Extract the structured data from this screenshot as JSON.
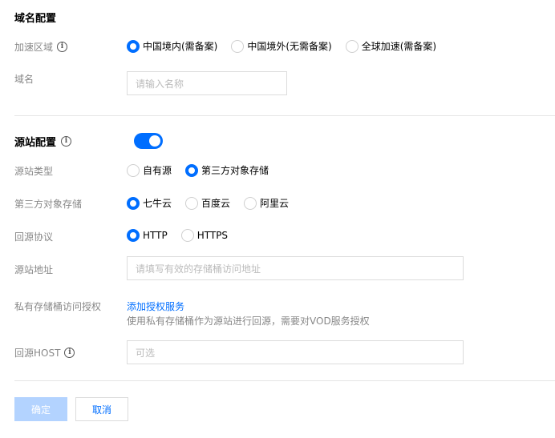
{
  "domain_section": {
    "title": "域名配置",
    "region_label": "加速区域",
    "region_options": [
      {
        "label": "中国境内(需备案)",
        "checked": true
      },
      {
        "label": "中国境外(无需备案)",
        "checked": false
      },
      {
        "label": "全球加速(需备案)",
        "checked": false
      }
    ],
    "domain_label": "域名",
    "domain_placeholder": "请输入名称"
  },
  "origin_section": {
    "title": "源站配置",
    "enabled": true,
    "type_label": "源站类型",
    "type_options": [
      {
        "label": "自有源",
        "checked": false
      },
      {
        "label": "第三方对象存储",
        "checked": true
      }
    ],
    "storage_label": "第三方对象存储",
    "storage_options": [
      {
        "label": "七牛云",
        "checked": true
      },
      {
        "label": "百度云",
        "checked": false
      },
      {
        "label": "阿里云",
        "checked": false
      }
    ],
    "protocol_label": "回源协议",
    "protocol_options": [
      {
        "label": "HTTP",
        "checked": true
      },
      {
        "label": "HTTPS",
        "checked": false
      }
    ],
    "address_label": "源站地址",
    "address_placeholder": "请填写有效的存储桶访问地址",
    "auth_label": "私有存储桶访问授权",
    "auth_link": "添加授权服务",
    "auth_helper": "使用私有存储桶作为源站进行回源，需要对VOD服务授权",
    "host_label": "回源HOST",
    "host_placeholder": "可选"
  },
  "actions": {
    "confirm": "确定",
    "cancel": "取消"
  },
  "colors": {
    "accent": "#006eff",
    "disabled_primary": "#b3d3ff"
  },
  "icons": {
    "info": "info-circle-icon"
  }
}
